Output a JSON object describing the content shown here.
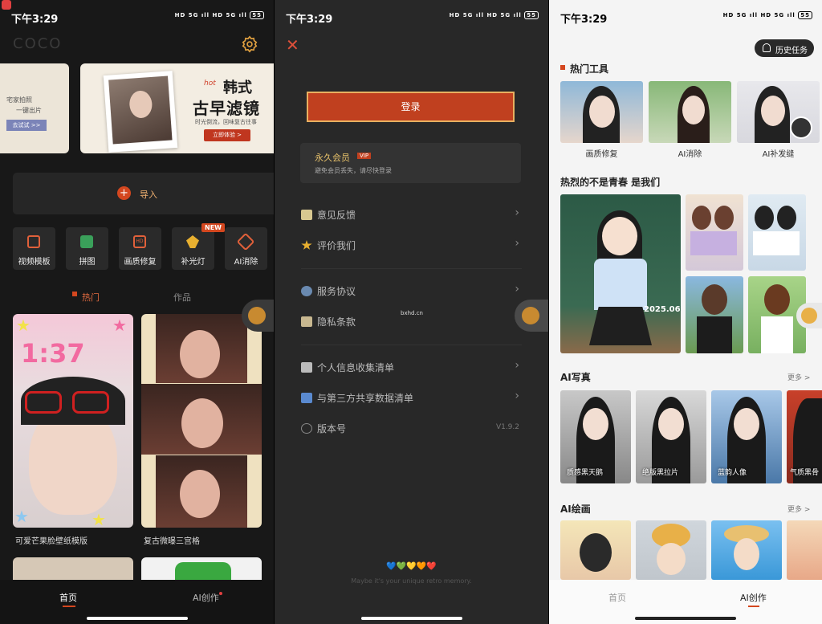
{
  "status_time": "下午3:29",
  "status_chips": "HD 5G ıll HD 5G ıll",
  "battery": "55",
  "home": {
    "logo": "COCO",
    "banner_left": {
      "line1": "宅家拍照",
      "line2": "一键出片",
      "button": "去试试 >>"
    },
    "banner_main": {
      "hot": "hot",
      "title1": "韩式",
      "title2": "古早滤镜",
      "subtitle": "时光倒流，回味复古往事",
      "button": "立即体验 >"
    },
    "import_label": "导入",
    "new_badge": "NEW",
    "tools": [
      {
        "label": "视频模板"
      },
      {
        "label": "拼图"
      },
      {
        "label": "画质修复"
      },
      {
        "label": "补光灯"
      },
      {
        "label": "AI消除"
      }
    ],
    "tabs": {
      "active": "热门",
      "inactive": "作品"
    },
    "cards": [
      {
        "title": "可爱芒果脸壁纸模版",
        "time": "1:37"
      },
      {
        "title": "复古微曝三宫格"
      }
    ],
    "bottom_nav": {
      "home": "首页",
      "ai": "AI创作"
    }
  },
  "menu": {
    "login": "登录",
    "vip": {
      "title": "永久会员",
      "badge": "VIP",
      "sub": "避免会员丢失，请尽快登录"
    },
    "items": [
      {
        "label": "意见反馈"
      },
      {
        "label": "评价我们"
      },
      {
        "label": "服务协议"
      },
      {
        "label": "隐私条款"
      },
      {
        "label": "个人信息收集清单"
      },
      {
        "label": "与第三方共享数据清单"
      },
      {
        "label": "版本号"
      }
    ],
    "version": "V1.9.2",
    "watermark": "bxhd.cn",
    "hearts": "💙💚💛🧡❤️",
    "tagline": "Maybe it's your unique retro memory."
  },
  "ai": {
    "history": "历史任务",
    "hot_tools_title": "热门工具",
    "hot_tools": [
      {
        "label": "画质修复"
      },
      {
        "label": "AI消除"
      },
      {
        "label": "AI补发缝"
      }
    ],
    "youth_title": "热烈的不是青春 是我们",
    "year_text": "2025.06",
    "portrait_title": "AI写真",
    "more": "更多 >",
    "portraits": [
      {
        "label": "质感黑天鹅"
      },
      {
        "label": "绝版黑拉片"
      },
      {
        "label": "蓝韵人像"
      },
      {
        "label": "气质黑骨"
      }
    ],
    "paint_title": "AI绘画",
    "bottom_nav": {
      "home": "首页",
      "ai": "AI创作"
    }
  },
  "colors": {
    "accent": "#d4471f",
    "vip_gold": "#e6c06a",
    "dark_bg": "#181818",
    "menu_bg": "#282828",
    "light_bg": "#f4f4f4"
  }
}
